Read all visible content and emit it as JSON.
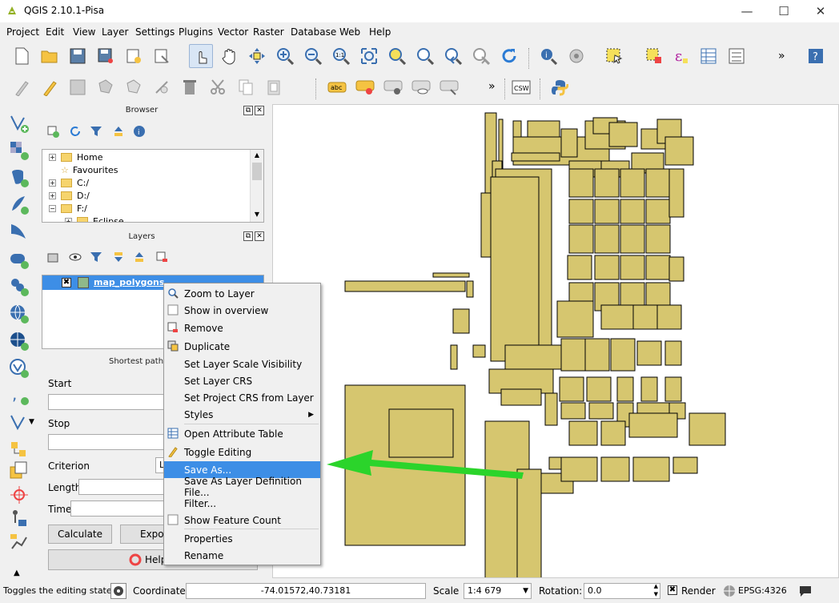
{
  "window": {
    "title": "QGIS 2.10.1-Pisa",
    "minimize": "—",
    "maximize": "☐",
    "close": "✕"
  },
  "menu": [
    "Project",
    "Edit",
    "View",
    "Layer",
    "Settings",
    "Plugins",
    "Vector",
    "Raster",
    "Database",
    "Web",
    "Help"
  ],
  "browser": {
    "title": "Browser",
    "items": [
      "Home",
      "Favourites",
      "C:/",
      "D:/",
      "F:/",
      "Eclipse"
    ]
  },
  "layers": {
    "title": "Layers",
    "layer_name": "map_polygons"
  },
  "shortest_path": {
    "title": "Shortest path",
    "start_label": "Start",
    "stop_label": "Stop",
    "criterion_label": "Criterion",
    "criterion_value": "L",
    "length_label": "Length",
    "time_label": "Time",
    "calculate_label": "Calculate",
    "export_label": "Export",
    "help_label": "Help"
  },
  "context_menu": {
    "items": [
      "Zoom to Layer",
      "Show in overview",
      "Remove",
      "Duplicate",
      "Set Layer Scale Visibility",
      "Set Layer CRS",
      "Set Project CRS from Layer",
      "Styles",
      "Open Attribute Table",
      "Toggle Editing",
      "Save As...",
      "Save As Layer Definition File...",
      "Filter...",
      "Show Feature Count",
      "Properties",
      "Rename"
    ],
    "highlighted": "Save As..."
  },
  "statusbar": {
    "message": "Toggles the editing state of",
    "coordinate_label": "Coordinate:",
    "coordinate_value": "-74.01572,40.73181",
    "scale_label": "Scale",
    "scale_value": "1:4 679",
    "rotation_label": "Rotation:",
    "rotation_value": "0.0",
    "render_label": "Render",
    "crs": "EPSG:4326"
  },
  "colors": {
    "polygon_fill": "#d6c66f",
    "polygon_stroke": "#000000",
    "highlight": "#3d8ee6",
    "arrow": "#2bd42b"
  },
  "toolbar_extra": {
    "csw": "CSW",
    "label_abc": "abc"
  }
}
